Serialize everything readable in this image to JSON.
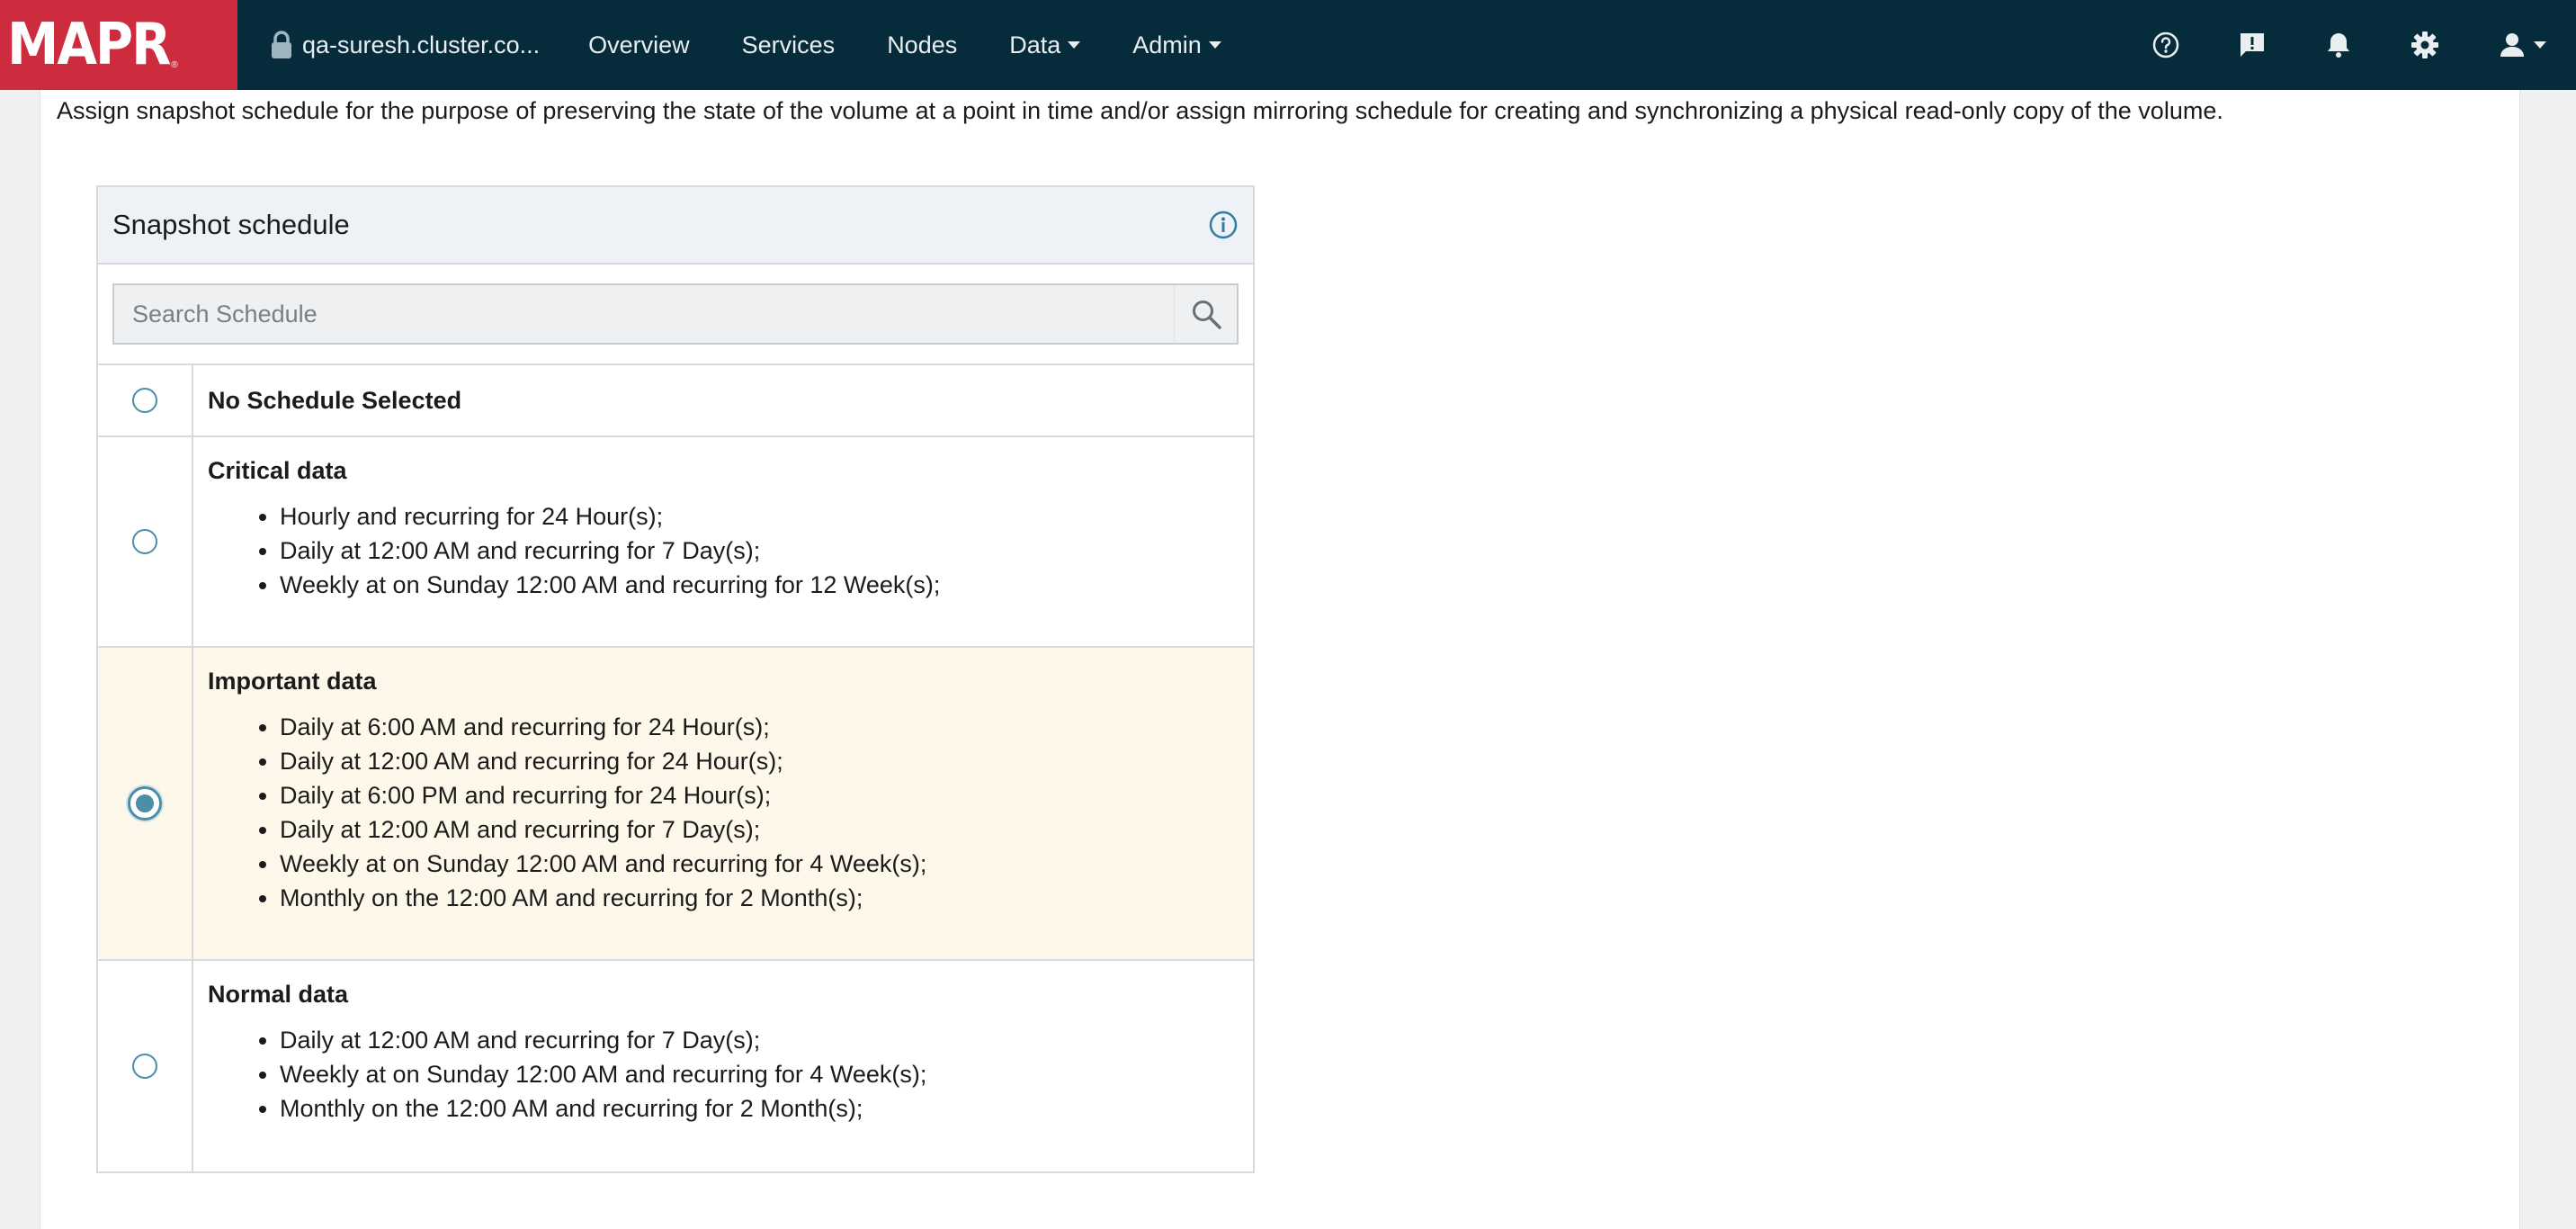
{
  "brand": {
    "logo_text": "MAPR",
    "registered": "®",
    "color": "#cc2c3e"
  },
  "navbar": {
    "background": "#062c3c",
    "cluster_name": "qa-suresh.cluster.co...",
    "items": [
      {
        "label": "Overview",
        "dropdown": false
      },
      {
        "label": "Services",
        "dropdown": false
      },
      {
        "label": "Nodes",
        "dropdown": false
      },
      {
        "label": "Data",
        "dropdown": true
      },
      {
        "label": "Admin",
        "dropdown": true
      }
    ],
    "icons": [
      "help-icon",
      "feedback-icon",
      "notifications-icon",
      "settings-icon",
      "user-icon"
    ]
  },
  "description": "Assign snapshot schedule for the purpose of preserving the state of the volume at a point in time and/or assign mirroring schedule for creating and synchronizing a physical read-only copy of the volume.",
  "snapshot": {
    "title": "Snapshot schedule",
    "search_placeholder": "Search Schedule",
    "no_schedule_label": "No Schedule Selected",
    "schedules": [
      {
        "name": "Critical data",
        "selected": false,
        "rules": [
          "Hourly and recurring for 24 Hour(s);",
          "Daily at 12:00 AM and recurring for 7 Day(s);",
          "Weekly at on Sunday 12:00 AM and recurring for 12 Week(s);"
        ]
      },
      {
        "name": "Important data",
        "selected": true,
        "rules": [
          "Daily at 6:00 AM and recurring for 24 Hour(s);",
          "Daily at 12:00 AM and recurring for 24 Hour(s);",
          "Daily at 6:00 PM and recurring for 24 Hour(s);",
          "Daily at 12:00 AM and recurring for 7 Day(s);",
          "Weekly at on Sunday 12:00 AM and recurring for 4 Week(s);",
          "Monthly on the 12:00 AM and recurring for 2 Month(s);"
        ]
      },
      {
        "name": "Normal data",
        "selected": false,
        "rules": [
          "Daily at 12:00 AM and recurring for 7 Day(s);",
          "Weekly at on Sunday 12:00 AM and recurring for 4 Week(s);",
          "Monthly on the 12:00 AM and recurring for 2 Month(s);"
        ]
      }
    ]
  }
}
